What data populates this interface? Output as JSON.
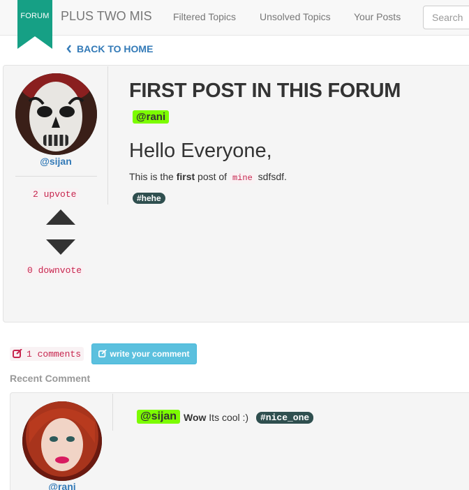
{
  "navbar": {
    "badge": "FORUM",
    "brand": "PLUS TWO MIS",
    "links": [
      "Filtered Topics",
      "Unsolved Topics",
      "Your Posts"
    ],
    "search_placeholder": "Search"
  },
  "back_link": "BACK TO HOME",
  "post": {
    "author": "@sijan",
    "upvotes": "2 upvote",
    "downvotes": "0 downvote",
    "title": "FIRST POST IN THIS FORUM",
    "mention": "@rani",
    "heading": "Hello Everyone,",
    "body": {
      "part1": "This is the ",
      "bold": "first",
      "part2": " post of ",
      "code": "mine",
      "part3": " sdfsdf."
    },
    "tag": "#hehe"
  },
  "comments": {
    "count_label": "1 comments",
    "write_button": "write your comment",
    "recent_label": "Recent Comment",
    "items": [
      {
        "author": "@rani",
        "mention": "@sijan",
        "bold_text": "Wow",
        "text": " Its cool :)",
        "tag": "#nice_one"
      }
    ]
  },
  "colors": {
    "accent": "#337ab7",
    "ribbon": "#16a085",
    "mention_bg": "#7cfc00",
    "tag_bg": "#2f4f4f",
    "info_button": "#5bc0de",
    "code_text": "#c7254e"
  }
}
